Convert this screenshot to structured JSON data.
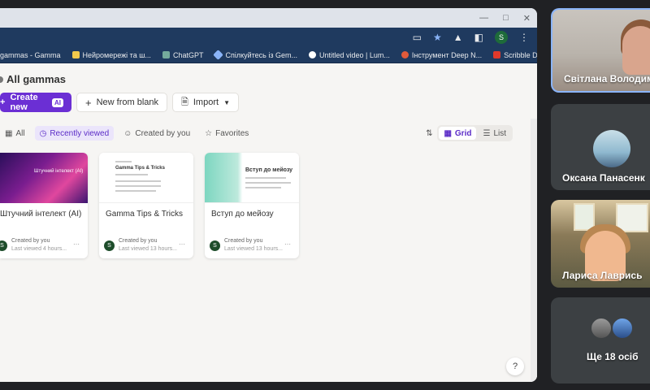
{
  "browser": {
    "bookmarks": [
      {
        "label": "gammas - Gamma",
        "color": "#e8eaed"
      },
      {
        "label": "Нейромережі та ш...",
        "color": "#f2c94c"
      },
      {
        "label": "ChatGPT",
        "color": "#74aa9c"
      },
      {
        "label": "Спілкуйтесь із Gem...",
        "color": "#8ab4f8"
      },
      {
        "label": "Untitled video | Lum...",
        "color": "#ffffff"
      },
      {
        "label": "Інструмент Deep N...",
        "color": "#e05a3a"
      },
      {
        "label": "Scribble Diffusion",
        "color": "#e0392b"
      }
    ],
    "profile_initial": "S"
  },
  "app": {
    "page_title": "All gammas",
    "create_label": "Create new",
    "ai_badge": "AI",
    "new_blank_label": "New from blank",
    "import_label": "Import",
    "filters": [
      {
        "label": "All",
        "icon": "grid-icon",
        "active": false
      },
      {
        "label": "Recently viewed",
        "icon": "clock-icon",
        "active": true
      },
      {
        "label": "Created by you",
        "icon": "person-icon",
        "active": false
      },
      {
        "label": "Favorites",
        "icon": "star-icon",
        "active": false
      }
    ],
    "view_grid": "Grid",
    "view_list": "List",
    "cards": [
      {
        "title": "Штучний інтелект (AI)",
        "thumb_title": "Штучний інтелект (AI)",
        "created": "Created by you",
        "viewed": "Last viewed 4 hours...",
        "avatar": "S"
      },
      {
        "title": "Gamma Tips & Tricks",
        "thumb_title": "Gamma Tips & Tricks",
        "created": "Created by you",
        "viewed": "Last viewed 13 hours...",
        "avatar": "S"
      },
      {
        "title": "Вступ до мейозу",
        "thumb_title": "Вступ до мейозу",
        "created": "Created by you",
        "viewed": "Last viewed 13 hours...",
        "avatar": "S"
      }
    ],
    "help_label": "?"
  },
  "participants": [
    {
      "name": "Світлана Володим"
    },
    {
      "name": "Оксана Панасенк"
    },
    {
      "name": "Лариса Лаврись"
    },
    {
      "name": "Ще 18 осіб"
    }
  ]
}
